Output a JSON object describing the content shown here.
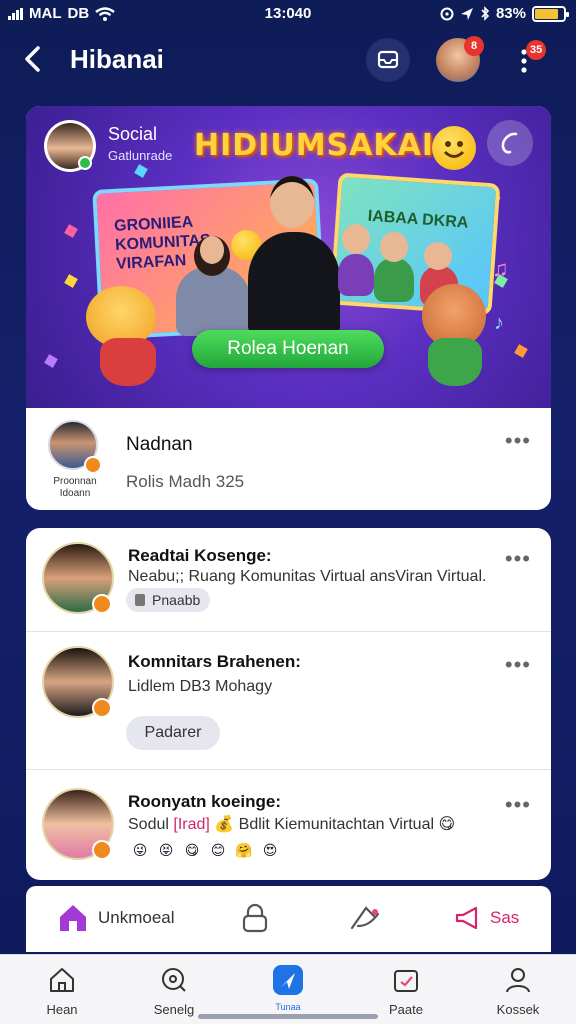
{
  "status_bar": {
    "carrier": "MAL",
    "network": "DB",
    "time": "13:040",
    "battery": "83%"
  },
  "header": {
    "title": "Hibanai",
    "avatar_badge": "8",
    "menu_badge": "35"
  },
  "featured_post": {
    "account_name": "Social",
    "account_sub": "Gatlunrade",
    "banner_title": "HIDIUMSAKAI",
    "panel_left_text": "GRONIIEA KOMUNITAS VIRAFAN",
    "panel_right_text": "IABAA DKRA",
    "cta_label": "Rolea Hoenan",
    "author_caption": "Proonnan Idoann",
    "author_name": "Nadnan",
    "author_meta": "Rolis Madh 325"
  },
  "list": [
    {
      "title": "Readtai Kosenge:",
      "subtitle": "Neabu;; Ruang Komunitas Virtual ansViran Virtual.",
      "chip": "Pnaabb"
    },
    {
      "title": "Komnitars Brahenen:",
      "subtitle": "Lidlem DB3 Mohagy",
      "chip": "Padarer"
    },
    {
      "title": "Roonyatn koeinge:",
      "subtitle_prefix": "Sodul",
      "subtitle_highlight": "[Irad]",
      "subtitle_rest": "💰 Bdlit Kiemunitachtan Virtual 😋",
      "emojis": [
        "😜",
        "😝",
        "😋",
        "😊",
        "🤗",
        "😍"
      ]
    }
  ],
  "actions": {
    "first_label": "Unkmoeal",
    "last_label": "Sas"
  },
  "bottom_nav": [
    {
      "label": "Hean"
    },
    {
      "label": "Senelg"
    },
    {
      "label": "Tunaa"
    },
    {
      "label": "Paate"
    },
    {
      "label": "Kossek"
    }
  ],
  "colors": {
    "accent": "#1e73e6",
    "brand_purple": "#5a2ec0",
    "cta_green": "#21a83a",
    "badge_red": "#e8342f"
  }
}
